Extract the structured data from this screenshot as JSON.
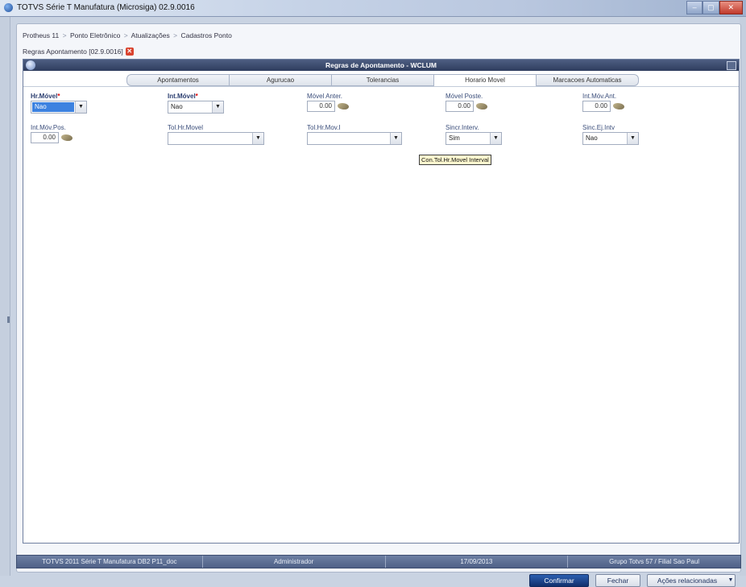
{
  "window": {
    "title": "TOTVS Série T Manufatura (Microsiga) 02.9.0016",
    "controls": [
      "–",
      "▢",
      "✕"
    ]
  },
  "breadcrumb": [
    "Protheus 11",
    "Ponto Eletrônico",
    "Atualizações",
    "Cadastros Ponto"
  ],
  "breadcrumb_separator": ">",
  "doc_tab": {
    "label": "Regras Apontamento [02.9.0016]",
    "close": "✕"
  },
  "dialog": {
    "title": "Regras de Apontamento - WCLUM",
    "tabs": [
      {
        "label": "Apontamentos",
        "accel": "A"
      },
      {
        "label": "Agurucao"
      },
      {
        "label": "Tolerancias",
        "accel": "T"
      },
      {
        "label": "Horario Movel",
        "accel": "H",
        "active": true
      },
      {
        "label": "Marcacoes Automaticas",
        "accel": "M"
      }
    ]
  },
  "fields": {
    "hr_movel": {
      "label": "Hr.Móvel",
      "value": "Nao",
      "selected": true
    },
    "int_movel": {
      "label": "Int.Móvel",
      "value": "Nao"
    },
    "movel_anter": {
      "label": "Móvel Anter.",
      "value": "0.00"
    },
    "movel_poste": {
      "label": "Móvel Poste.",
      "value": "0.00"
    },
    "int_mov_ant": {
      "label": "Int.Móv.Ant.",
      "value": "0.00"
    },
    "int_mov_pos": {
      "label": "Int.Móv.Pos.",
      "value": "0.00"
    },
    "tol_hr_movel": {
      "label": "Tol.Hr.Movel",
      "value": ""
    },
    "tol_hr_mov_i": {
      "label": "Tol.Hr.Mov.I",
      "value": ""
    },
    "sincr_interv": {
      "label": "Sincr.Interv.",
      "value": "Sim"
    },
    "sinc_ej_intv": {
      "label": "Sinc.Ej.Intv",
      "value": "Nao"
    }
  },
  "tooltip": "Con.Tol.Hr.Movel Interval",
  "required_marker": "*",
  "dropdown_arrow": "▼",
  "buttons": {
    "confirm": "Confirmar",
    "close": "Fechar",
    "actions": "Ações relacionadas",
    "actions_arrow": "▼"
  },
  "statusbar": [
    "TOTVS 2011 Série T Manufatura DB2 P11_doc",
    "Administrador",
    "17/09/2013",
    "Grupo Totvs 57 / Filial Sao Paul"
  ],
  "colors": {
    "header": "#2f3d5e",
    "accent": "#3d82e0",
    "primary_button": "#12306d",
    "tooltip": "#fff9cf"
  }
}
